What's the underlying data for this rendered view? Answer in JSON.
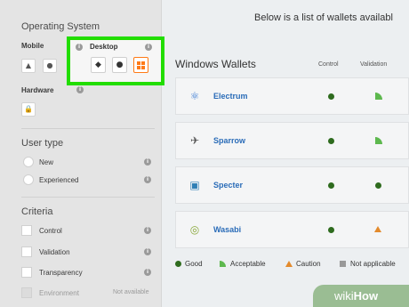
{
  "intro": "Below is a list of wallets availabl",
  "sidebar": {
    "os_title": "Operating System",
    "mobile_label": "Mobile",
    "mobile_buttons": [
      {
        "name": "android",
        "glyph": "🤖"
      },
      {
        "name": "apple",
        "glyph": ""
      }
    ],
    "desktop_label": "Desktop",
    "desktop_buttons": [
      {
        "name": "linux",
        "glyph": "🐧"
      },
      {
        "name": "mac",
        "glyph": ""
      },
      {
        "name": "windows",
        "glyph": ""
      }
    ],
    "hardware_label": "Hardware",
    "info_glyph": "i",
    "user_type_title": "User type",
    "user_types": [
      "New",
      "Experienced"
    ],
    "criteria_title": "Criteria",
    "criteria": [
      "Control",
      "Validation",
      "Transparency"
    ],
    "environment_label": "Environment",
    "not_available": "Not available"
  },
  "main": {
    "section_title": "Windows Wallets",
    "columns": [
      "Control",
      "Validation"
    ],
    "wallets": [
      {
        "name": "Electrum",
        "icon": "electrum-icon",
        "control": "good",
        "validation": "acceptable",
        "color": "#3b7bd4"
      },
      {
        "name": "Sparrow",
        "icon": "sparrow-icon",
        "control": "good",
        "validation": "acceptable",
        "color": "#555555"
      },
      {
        "name": "Specter",
        "icon": "specter-icon",
        "control": "good",
        "validation": "good",
        "color": "#2f7fb5"
      },
      {
        "name": "Wasabi",
        "icon": "wasabi-icon",
        "control": "good",
        "validation": "caution",
        "color": "#8aa83a"
      }
    ]
  },
  "legend": {
    "good": "Good",
    "acceptable": "Acceptable",
    "caution": "Caution",
    "not_applicable": "Not applicable"
  },
  "colors": {
    "good": "#2e6b1e",
    "acceptable": "#5db84e",
    "caution": "#e38a2c",
    "not_applicable": "#999999",
    "highlight": "#22dd00",
    "selected": "#ff7a16",
    "link": "#2a6cb8"
  },
  "watermark": {
    "prefix": "wiki",
    "suffix": "How"
  }
}
